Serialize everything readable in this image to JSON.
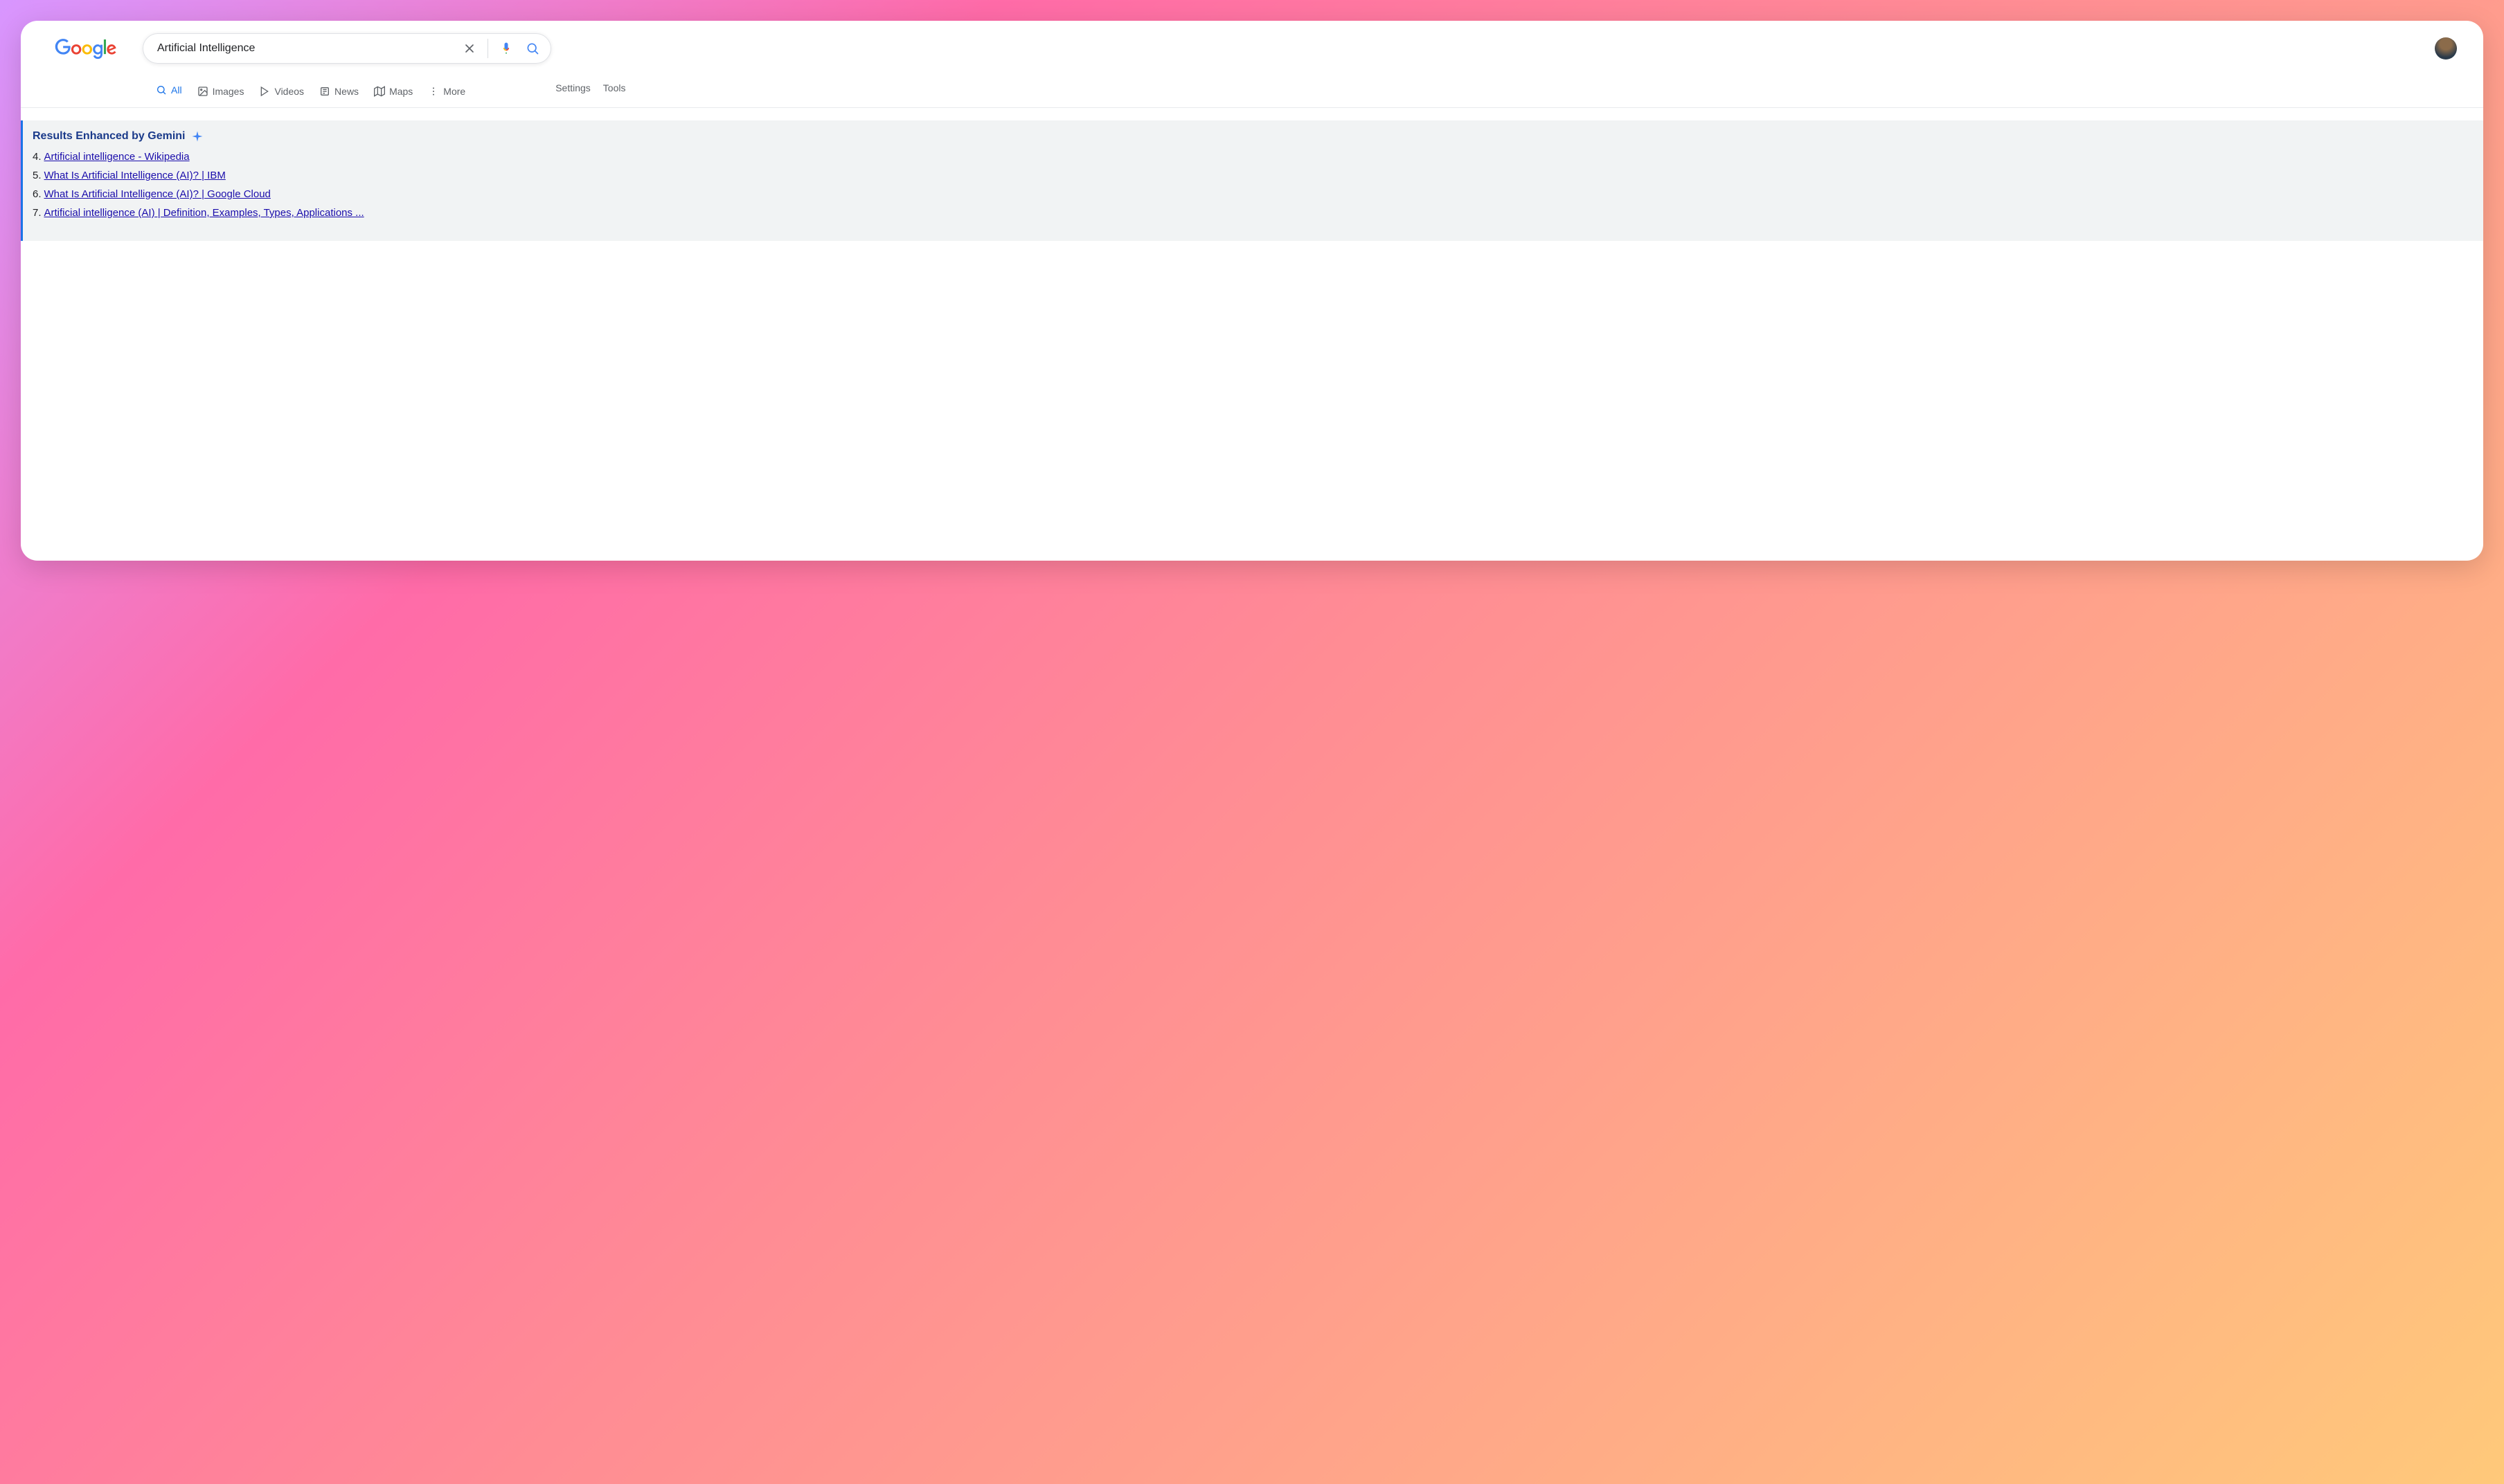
{
  "search": {
    "query": "Artificial Intelligence"
  },
  "tabs": [
    {
      "label": "All",
      "icon": "search"
    },
    {
      "label": "Images",
      "icon": "image"
    },
    {
      "label": "Videos",
      "icon": "play"
    },
    {
      "label": "News",
      "icon": "news"
    },
    {
      "label": "Maps",
      "icon": "map"
    },
    {
      "label": "More",
      "icon": "more"
    }
  ],
  "nav_right": {
    "settings": "Settings",
    "tools": "Tools"
  },
  "gemini": {
    "title": "Results Enhanced by Gemini",
    "results": [
      {
        "num": "4.",
        "title": "Artificial intelligence - Wikipedia"
      },
      {
        "num": "5.",
        "title": "What Is Artificial Intelligence (AI)? | IBM"
      },
      {
        "num": "6.",
        "title": "What Is Artificial Intelligence (AI)? | Google Cloud"
      },
      {
        "num": "7.",
        "title": "Artificial intelligence (AI) | Definition, Examples, Types, Applications ..."
      }
    ]
  }
}
